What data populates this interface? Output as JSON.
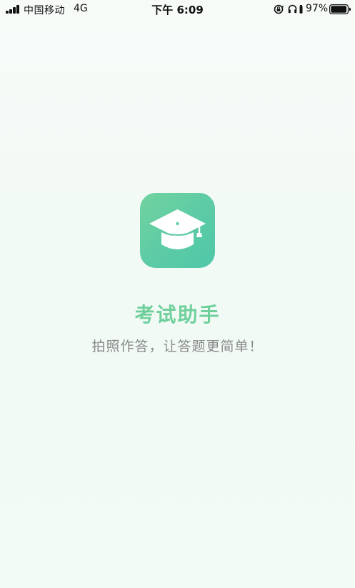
{
  "status_bar": {
    "carrier": "中国移动",
    "network": "4G",
    "time": "下午 6:09",
    "battery_percent": "97%",
    "battery_level": 0.97,
    "icons": [
      "signal-icon",
      "orientation-lock-icon",
      "headphones-icon",
      "battery-icon"
    ]
  },
  "splash": {
    "app_icon": "graduation-cap-icon",
    "title": "考试助手",
    "tagline": "拍照作答，让答题更简单！"
  },
  "colors": {
    "accent": "#6fd09c",
    "icon_gradient_start": "#72d39f",
    "icon_gradient_end": "#4fc7a8",
    "tagline": "#8a8a8a"
  }
}
